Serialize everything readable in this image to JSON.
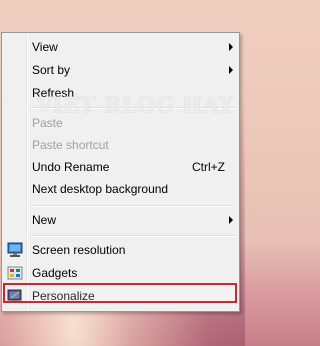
{
  "menu": {
    "view": {
      "label": "View"
    },
    "sort_by": {
      "label": "Sort by"
    },
    "refresh": {
      "label": "Refresh"
    },
    "paste": {
      "label": "Paste"
    },
    "paste_shortcut": {
      "label": "Paste shortcut"
    },
    "undo_rename": {
      "label": "Undo Rename",
      "shortcut": "Ctrl+Z"
    },
    "next_background": {
      "label": "Next desktop background"
    },
    "new": {
      "label": "New"
    },
    "screen_resolution": {
      "label": "Screen resolution",
      "icon": "monitor-icon"
    },
    "gadgets": {
      "label": "Gadgets",
      "icon": "gadgets-icon"
    },
    "personalize": {
      "label": "Personalize",
      "icon": "personalize-icon"
    }
  },
  "watermark": "VIET BLOG HAY",
  "colors": {
    "highlight_border": "#d8232a",
    "menu_bg": "#f0f0f0"
  }
}
